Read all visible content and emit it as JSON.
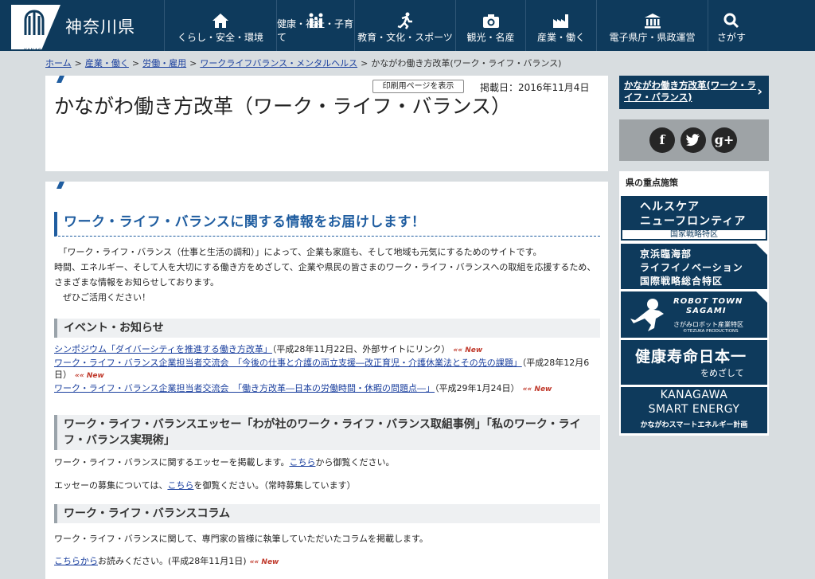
{
  "header": {
    "logo_name": "神奈川県",
    "logo_small": "KANAGAWA",
    "nav": [
      {
        "label": "くらし・安全・環境",
        "icon": "home-icon"
      },
      {
        "label": "健康・福祉・子育て",
        "icon": "family-icon"
      },
      {
        "label": "教育・文化・スポーツ",
        "icon": "runner-icon"
      },
      {
        "label": "観光・名産",
        "icon": "camera-icon"
      },
      {
        "label": "産業・働く",
        "icon": "factory-icon"
      },
      {
        "label": "電子県庁・県政運営",
        "icon": "government-icon"
      },
      {
        "label": "さがす",
        "icon": "search-icon"
      }
    ]
  },
  "breadcrumb": [
    {
      "label": "ホーム"
    },
    {
      "label": "産業・働く"
    },
    {
      "label": "労働・雇用"
    },
    {
      "label": "ワークライフバランス・メンタルヘルス"
    },
    {
      "label": "かながわ働き方改革(ワーク・ライフ・バランス)"
    }
  ],
  "title_box": {
    "print_button": "印刷用ページを表示",
    "posted": "掲載日：2016年11月4日",
    "title": "かながわ働き方改革（ワーク・ライフ・バランス）"
  },
  "content": {
    "heading": "ワーク・ライフ・バランスに関する情報をお届けします！",
    "intro_1": "　「ワーク・ライフ・バランス（仕事と生活の調和）」によって、企業も家庭も、そして地域も元気にするためのサイトです。",
    "intro_2": "時間、エネルギー、そして人を大切にする働き方をめざして、企業や県民の皆さまのワーク・ライフ・バランスへの取組を応援するため、さまざまな情報をお知らせしております。",
    "intro_3": "　ぜひご活用ください！",
    "events_heading": "イベント・お知らせ",
    "events": [
      {
        "link": "シンポジウム「ダイバーシティを推進する働き方改革」",
        "note": "（平成28年11月22日、外部サイトにリンク）",
        "badge": "New"
      },
      {
        "link": "ワーク・ライフ・バランス企業担当者交流会　「今後の仕事と介護の両立支援―改正育児・介護休業法とその先の課題」",
        "note": "（平成28年12月6日）",
        "badge": "New"
      },
      {
        "link": "ワーク・ライフ・バランス企業担当者交流会　「働き方改革―日本の労働時間・休暇の問題点―」",
        "note": "（平成29年1月24日）",
        "badge": "New"
      }
    ],
    "essay_heading": "ワーク・ライフ・バランスエッセー「わが社のワーク・ライフ・バランス取組事例」「私のワーク・ライフ・バランス実現術」",
    "essay_p1_pre": "ワーク・ライフ・バランスに関するエッセーを掲載します。",
    "essay_p1_link": "こちら",
    "essay_p1_post": "から御覧ください。",
    "essay_p2_pre": "エッセーの募集については、",
    "essay_p2_link": "こちら",
    "essay_p2_post": "を御覧ください。（常時募集しています）",
    "column_heading": "ワーク・ライフ・バランスコラム",
    "column_p1": "ワーク・ライフ・バランスに関して、専門家の皆様に執筆していただいたコラムを掲載します。",
    "column_p2_link": "こちらから",
    "column_p2_post": "お読みください。(平成28年11月1日)",
    "column_badge": "New"
  },
  "sidebar": {
    "page_link": "かながわ働き方改革(ワーク・ライフ・バランス)",
    "social": [
      "f",
      "t",
      "g+"
    ],
    "priority_title": "県の重点施策",
    "banners": {
      "b1": {
        "l1": "ヘルスケア",
        "l2": "ニューフロンティア",
        "l3": "国家戦略特区"
      },
      "b2": {
        "l1": "京浜臨海部",
        "l2": "ライフイノベーション",
        "l3": "国際戦略総合特区"
      },
      "b3": {
        "l1": "ROBOT TOWN",
        "l2": "SAGAMI",
        "l3": "さがみロボット産業特区",
        "l4": "©TEZUKA PRODUCTIONS"
      },
      "b4": {
        "l1": "健康寿命日本一",
        "l2": "をめざして"
      },
      "b5": {
        "l1": "KANAGAWA",
        "l2": "SMART ENERGY",
        "l3": "かながわスマートエネルギー計画"
      }
    }
  }
}
